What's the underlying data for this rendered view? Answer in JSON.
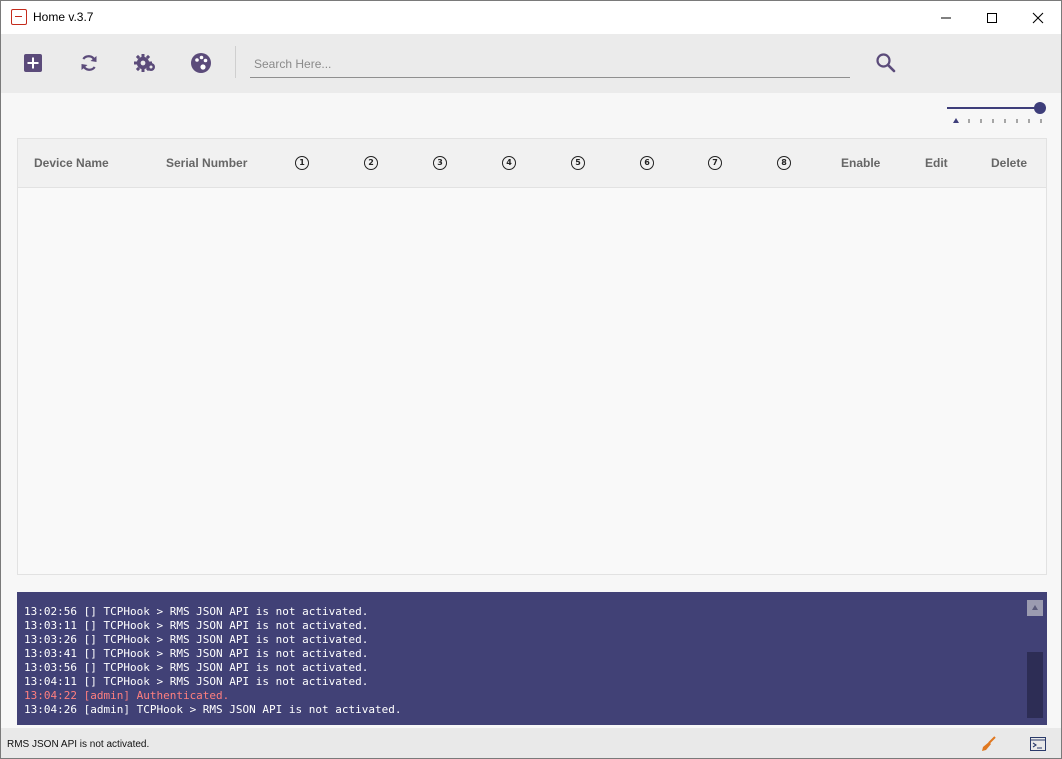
{
  "window": {
    "title": "Home v.3.7"
  },
  "toolbar": {
    "buttons": [
      {
        "icon": "add-icon"
      },
      {
        "icon": "refresh-icon"
      },
      {
        "icon": "settings-icon"
      },
      {
        "icon": "palette-icon"
      }
    ],
    "search": {
      "placeholder": "Search Here...",
      "value": ""
    },
    "accent_color": "#5b4b7a"
  },
  "zoom_slider": {
    "level": 1.0
  },
  "table": {
    "columns": [
      "Device Name",
      "Serial Number",
      "1",
      "2",
      "3",
      "4",
      "5",
      "6",
      "7",
      "8",
      "Enable",
      "Edit",
      "Delete"
    ],
    "rows": []
  },
  "console": {
    "background": "#414176",
    "lines": [
      {
        "text": "13:02:56 [] TCPHook > RMS JSON API is not activated.",
        "highlight": false
      },
      {
        "text": "13:03:11 [] TCPHook > RMS JSON API is not activated.",
        "highlight": false
      },
      {
        "text": "13:03:26 [] TCPHook > RMS JSON API is not activated.",
        "highlight": false
      },
      {
        "text": "13:03:41 [] TCPHook > RMS JSON API is not activated.",
        "highlight": false
      },
      {
        "text": "13:03:56 [] TCPHook > RMS JSON API is not activated.",
        "highlight": false
      },
      {
        "text": "13:04:11 [] TCPHook > RMS JSON API is not activated.",
        "highlight": false
      },
      {
        "text": "13:04:22 [admin] Authenticated.",
        "highlight": true
      },
      {
        "text": "13:04:26 [admin] TCPHook > RMS JSON API is not activated.",
        "highlight": false
      }
    ],
    "highlight_color": "#ff7f7f"
  },
  "statusbar": {
    "message": "RMS JSON API is not activated.",
    "icons": [
      "broom-icon",
      "terminal-icon"
    ]
  }
}
